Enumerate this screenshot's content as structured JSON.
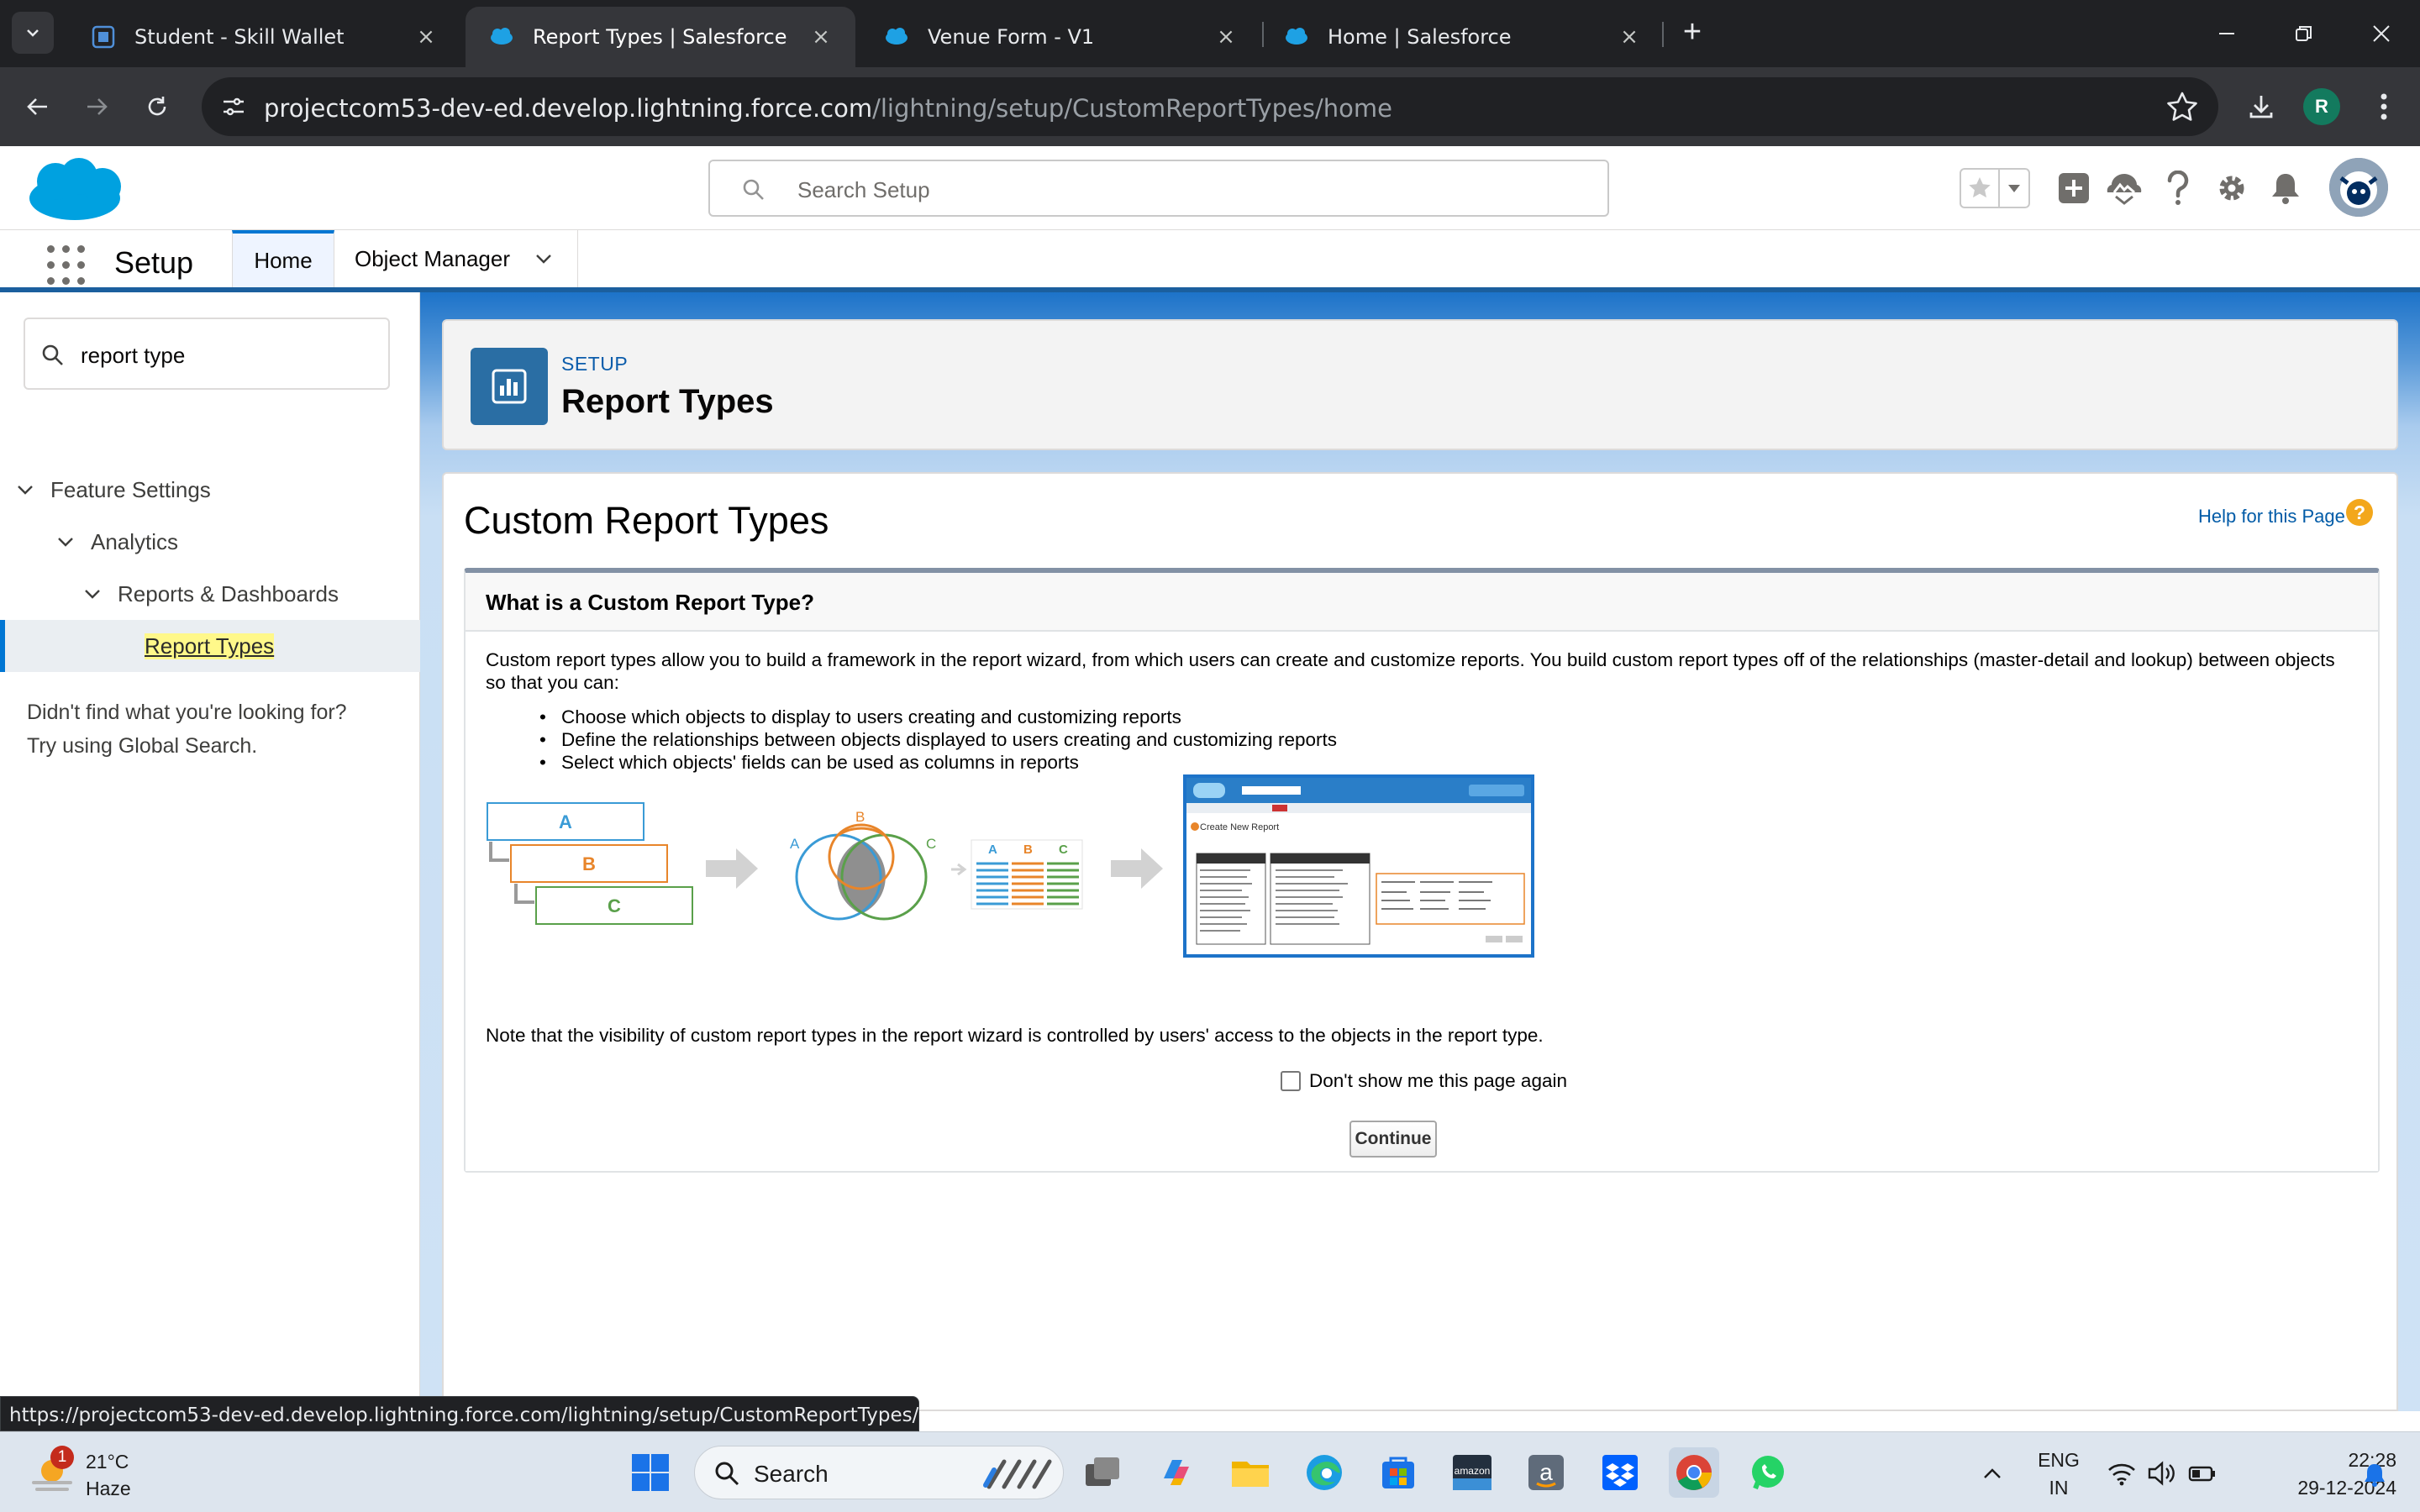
{
  "browser": {
    "tabs": [
      {
        "title": "Student - Skill Wallet",
        "active": false
      },
      {
        "title": "Report Types | Salesforce",
        "active": true
      },
      {
        "title": "Venue Form - V1",
        "active": false
      },
      {
        "title": "Home | Salesforce",
        "active": false
      }
    ],
    "url_host": "projectcom53-dev-ed.develop.lightning.force.com",
    "url_path": "/lightning/setup/CustomReportTypes/home",
    "profile_initial": "R",
    "status_url": "https://projectcom53-dev-ed.develop.lightning.force.com/lightning/setup/CustomReportTypes/home"
  },
  "sf_header": {
    "search_placeholder": "Search Setup"
  },
  "sf_nav": {
    "app_name": "Setup",
    "tabs": [
      "Home",
      "Object Manager"
    ]
  },
  "tree": {
    "quick_find_value": "report type",
    "items": [
      "Feature Settings",
      "Analytics",
      "Reports & Dashboards",
      "Report Types"
    ],
    "not_found_line1": "Didn't find what you're looking for?",
    "not_found_line2": "Try using Global Search."
  },
  "page_header": {
    "eyebrow": "SETUP",
    "title": "Report Types"
  },
  "main": {
    "title": "Custom Report Types",
    "help_link": "Help for this Page",
    "help_icon_glyph": "?",
    "section_title": "What is a Custom Report Type?",
    "intro": "Custom report types allow you to build a framework in the report wizard, from which users can create and customize reports. You build custom report types off of the relationships (master-detail and lookup) between objects so that you can:",
    "bullets": [
      "Choose which objects to display to users creating and customizing reports",
      "Define the relationships between objects displayed to users creating and customizing reports",
      "Select which objects' fields can be used as columns in reports"
    ],
    "diagram_labels": [
      "A",
      "B",
      "C"
    ],
    "diagram_screenshot_title": "Create New Report",
    "note": "Note that the visibility of custom report types in the report wizard is controlled by users' access to the objects in the report type.",
    "checkbox_label": "Don't show me this page again",
    "checkbox_checked": false,
    "continue_label": "Continue"
  },
  "taskbar": {
    "weather_temp": "21°C",
    "weather_cond": "Haze",
    "weather_badge": "1",
    "search_label": "Search",
    "lang_line1": "ENG",
    "lang_line2": "IN",
    "time": "22:28",
    "date": "29-12-2024"
  },
  "colors": {
    "sf_brand_blue": "#0176d3",
    "header_icon_bg": "#2a6ea4",
    "chrome_dark": "#202124",
    "diagram_blue": "#3a9bd6",
    "diagram_orange": "#e8852a",
    "diagram_green": "#5aa04a"
  }
}
